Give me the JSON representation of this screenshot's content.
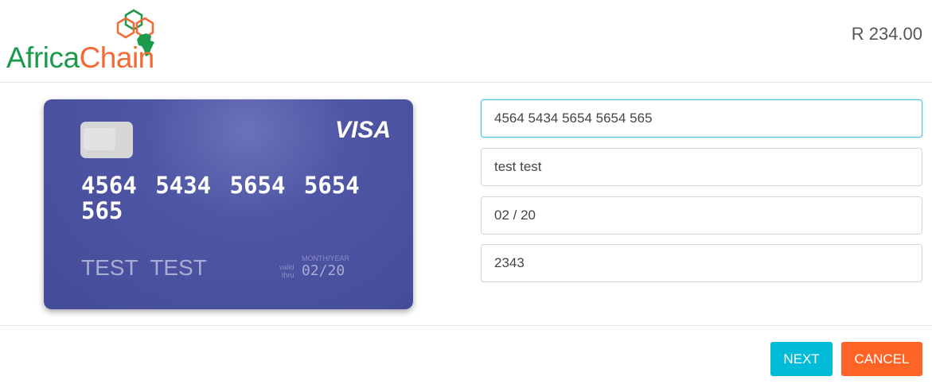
{
  "header": {
    "logo": {
      "part1": "Africa",
      "part2": "Chain"
    },
    "amount": "R 234.00"
  },
  "card": {
    "brand": "VISA",
    "number": "4564 5434 5654 5654 565",
    "holder": "TEST TEST",
    "valid_label_1": "valid",
    "valid_label_2": "thru",
    "expiry_label": "MONTH/YEAR",
    "expiry": "02/20"
  },
  "form": {
    "card_number": "4564 5434 5654 5654 565",
    "name": "test test",
    "expiry": "02 / 20",
    "cvc": "2343"
  },
  "buttons": {
    "next": "NEXT",
    "cancel": "CANCEL"
  },
  "colors": {
    "green": "#1a9a4a",
    "orange": "#f26a35",
    "next": "#00bcd8",
    "cancel": "#ff6427",
    "card": "#4a519f"
  }
}
